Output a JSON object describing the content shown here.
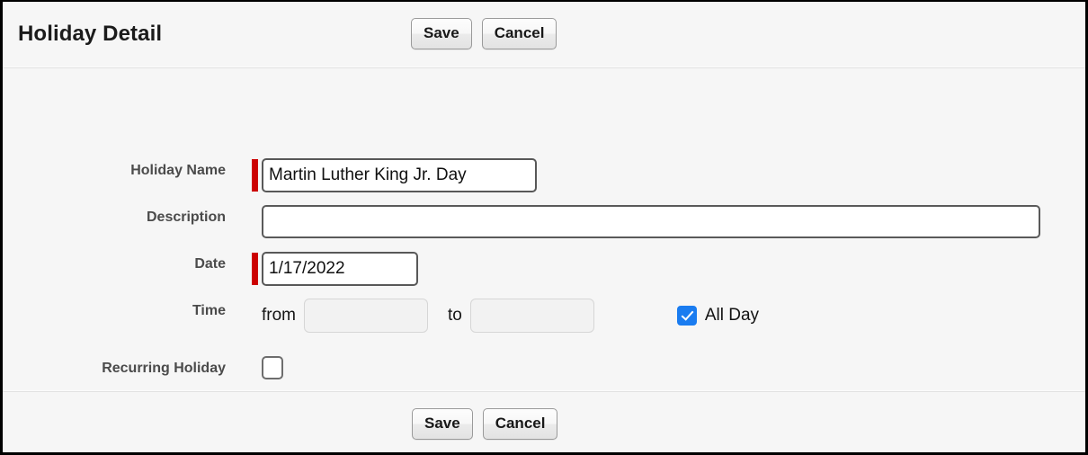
{
  "window": {
    "title": "Holiday Detail"
  },
  "header": {
    "save_label": "Save",
    "cancel_label": "Cancel"
  },
  "footer": {
    "save_label": "Save",
    "cancel_label": "Cancel"
  },
  "form": {
    "holiday_name": {
      "label": "Holiday Name",
      "value": "Martin Luther King Jr. Day",
      "placeholder": "",
      "required": true
    },
    "description": {
      "label": "Description",
      "value": "",
      "placeholder": "",
      "required": false
    },
    "date": {
      "label": "Date",
      "value": "1/17/2022",
      "placeholder": "",
      "required": true
    },
    "time": {
      "label": "Time",
      "from_word": "from",
      "to_word": "to",
      "from_value": "",
      "to_value": "",
      "from_placeholder": "",
      "to_placeholder": "",
      "all_day_label": "All Day",
      "all_day_checked": "true"
    },
    "recurring": {
      "label": "Recurring Holiday",
      "checked": "false"
    }
  },
  "colors": {
    "required_bar": "#cc0000",
    "checkbox_checked": "#1a7cf0",
    "background": "#f6f6f6",
    "label_text": "#4b4b4b"
  }
}
